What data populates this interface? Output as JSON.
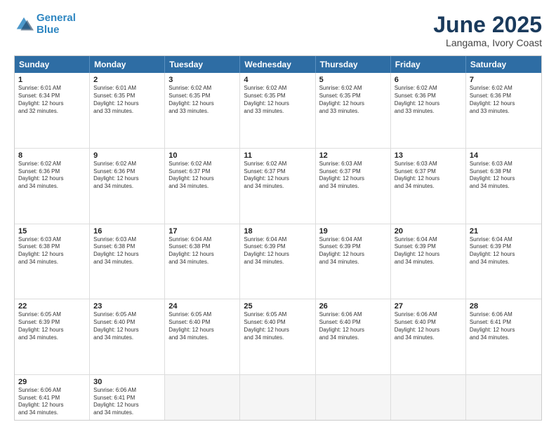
{
  "header": {
    "logo_line1": "General",
    "logo_line2": "Blue",
    "title": "June 2025",
    "subtitle": "Langama, Ivory Coast"
  },
  "calendar": {
    "days_of_week": [
      "Sunday",
      "Monday",
      "Tuesday",
      "Wednesday",
      "Thursday",
      "Friday",
      "Saturday"
    ],
    "weeks": [
      [
        {
          "day": "",
          "info": ""
        },
        {
          "day": "2",
          "info": "Sunrise: 6:01 AM\nSunset: 6:35 PM\nDaylight: 12 hours\nand 33 minutes."
        },
        {
          "day": "3",
          "info": "Sunrise: 6:02 AM\nSunset: 6:35 PM\nDaylight: 12 hours\nand 33 minutes."
        },
        {
          "day": "4",
          "info": "Sunrise: 6:02 AM\nSunset: 6:35 PM\nDaylight: 12 hours\nand 33 minutes."
        },
        {
          "day": "5",
          "info": "Sunrise: 6:02 AM\nSunset: 6:35 PM\nDaylight: 12 hours\nand 33 minutes."
        },
        {
          "day": "6",
          "info": "Sunrise: 6:02 AM\nSunset: 6:36 PM\nDaylight: 12 hours\nand 33 minutes."
        },
        {
          "day": "7",
          "info": "Sunrise: 6:02 AM\nSunset: 6:36 PM\nDaylight: 12 hours\nand 33 minutes."
        }
      ],
      [
        {
          "day": "1",
          "info": "Sunrise: 6:01 AM\nSunset: 6:34 PM\nDaylight: 12 hours\nand 32 minutes."
        },
        {
          "day": "",
          "info": ""
        },
        {
          "day": "",
          "info": ""
        },
        {
          "day": "",
          "info": ""
        },
        {
          "day": "",
          "info": ""
        },
        {
          "day": "",
          "info": ""
        },
        {
          "day": "",
          "info": ""
        }
      ],
      [
        {
          "day": "8",
          "info": "Sunrise: 6:02 AM\nSunset: 6:36 PM\nDaylight: 12 hours\nand 34 minutes."
        },
        {
          "day": "9",
          "info": "Sunrise: 6:02 AM\nSunset: 6:36 PM\nDaylight: 12 hours\nand 34 minutes."
        },
        {
          "day": "10",
          "info": "Sunrise: 6:02 AM\nSunset: 6:37 PM\nDaylight: 12 hours\nand 34 minutes."
        },
        {
          "day": "11",
          "info": "Sunrise: 6:02 AM\nSunset: 6:37 PM\nDaylight: 12 hours\nand 34 minutes."
        },
        {
          "day": "12",
          "info": "Sunrise: 6:03 AM\nSunset: 6:37 PM\nDaylight: 12 hours\nand 34 minutes."
        },
        {
          "day": "13",
          "info": "Sunrise: 6:03 AM\nSunset: 6:37 PM\nDaylight: 12 hours\nand 34 minutes."
        },
        {
          "day": "14",
          "info": "Sunrise: 6:03 AM\nSunset: 6:38 PM\nDaylight: 12 hours\nand 34 minutes."
        }
      ],
      [
        {
          "day": "15",
          "info": "Sunrise: 6:03 AM\nSunset: 6:38 PM\nDaylight: 12 hours\nand 34 minutes."
        },
        {
          "day": "16",
          "info": "Sunrise: 6:03 AM\nSunset: 6:38 PM\nDaylight: 12 hours\nand 34 minutes."
        },
        {
          "day": "17",
          "info": "Sunrise: 6:04 AM\nSunset: 6:38 PM\nDaylight: 12 hours\nand 34 minutes."
        },
        {
          "day": "18",
          "info": "Sunrise: 6:04 AM\nSunset: 6:39 PM\nDaylight: 12 hours\nand 34 minutes."
        },
        {
          "day": "19",
          "info": "Sunrise: 6:04 AM\nSunset: 6:39 PM\nDaylight: 12 hours\nand 34 minutes."
        },
        {
          "day": "20",
          "info": "Sunrise: 6:04 AM\nSunset: 6:39 PM\nDaylight: 12 hours\nand 34 minutes."
        },
        {
          "day": "21",
          "info": "Sunrise: 6:04 AM\nSunset: 6:39 PM\nDaylight: 12 hours\nand 34 minutes."
        }
      ],
      [
        {
          "day": "22",
          "info": "Sunrise: 6:05 AM\nSunset: 6:39 PM\nDaylight: 12 hours\nand 34 minutes."
        },
        {
          "day": "23",
          "info": "Sunrise: 6:05 AM\nSunset: 6:40 PM\nDaylight: 12 hours\nand 34 minutes."
        },
        {
          "day": "24",
          "info": "Sunrise: 6:05 AM\nSunset: 6:40 PM\nDaylight: 12 hours\nand 34 minutes."
        },
        {
          "day": "25",
          "info": "Sunrise: 6:05 AM\nSunset: 6:40 PM\nDaylight: 12 hours\nand 34 minutes."
        },
        {
          "day": "26",
          "info": "Sunrise: 6:06 AM\nSunset: 6:40 PM\nDaylight: 12 hours\nand 34 minutes."
        },
        {
          "day": "27",
          "info": "Sunrise: 6:06 AM\nSunset: 6:40 PM\nDaylight: 12 hours\nand 34 minutes."
        },
        {
          "day": "28",
          "info": "Sunrise: 6:06 AM\nSunset: 6:41 PM\nDaylight: 12 hours\nand 34 minutes."
        }
      ],
      [
        {
          "day": "29",
          "info": "Sunrise: 6:06 AM\nSunset: 6:41 PM\nDaylight: 12 hours\nand 34 minutes."
        },
        {
          "day": "30",
          "info": "Sunrise: 6:06 AM\nSunset: 6:41 PM\nDaylight: 12 hours\nand 34 minutes."
        },
        {
          "day": "",
          "info": ""
        },
        {
          "day": "",
          "info": ""
        },
        {
          "day": "",
          "info": ""
        },
        {
          "day": "",
          "info": ""
        },
        {
          "day": "",
          "info": ""
        }
      ]
    ]
  }
}
